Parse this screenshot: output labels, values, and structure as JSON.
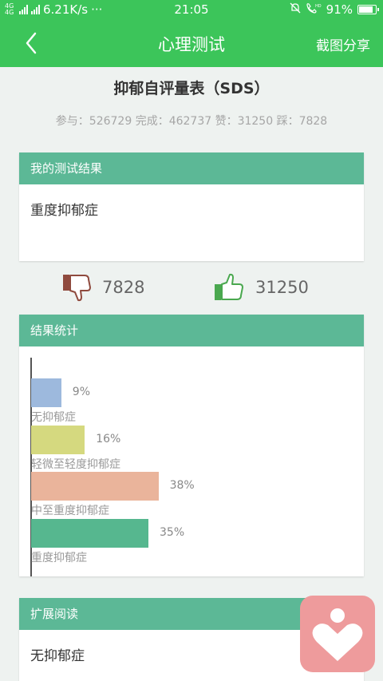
{
  "statusbar": {
    "net_type": "4G 4G",
    "speed": "6.21K/s",
    "dots": "···",
    "time": "21:05",
    "battery": "91%",
    "battery_level": 0.91
  },
  "header": {
    "title": "心理测试",
    "share_label": "截图分享"
  },
  "survey": {
    "title": "抑郁自评量表（SDS）",
    "stats": "参与：526729 完成：462737 赞：31250 踩：7828"
  },
  "result_card": {
    "header": "我的测试结果",
    "result": "重度抑郁症"
  },
  "votes": {
    "dislike_count": "7828",
    "like_count": "31250"
  },
  "stats_card": {
    "header": "结果统计"
  },
  "chart_data": {
    "type": "bar",
    "orientation": "horizontal",
    "categories": [
      "无抑郁症",
      "轻微至轻度抑郁症",
      "中至重度抑郁症",
      "重度抑郁症"
    ],
    "values": [
      9,
      16,
      38,
      35
    ],
    "value_labels": [
      "9%",
      "16%",
      "38%",
      "35%"
    ],
    "colors": [
      "#9db9dd",
      "#d5d97f",
      "#eab49b",
      "#56b78f"
    ],
    "xlim": [
      0,
      100
    ]
  },
  "reading_card": {
    "header": "扩展阅读",
    "item": "无抑郁症"
  },
  "colors": {
    "primary_green": "#3cc55a",
    "card_header": "#5cb896",
    "fab": "#ee9b9c"
  }
}
